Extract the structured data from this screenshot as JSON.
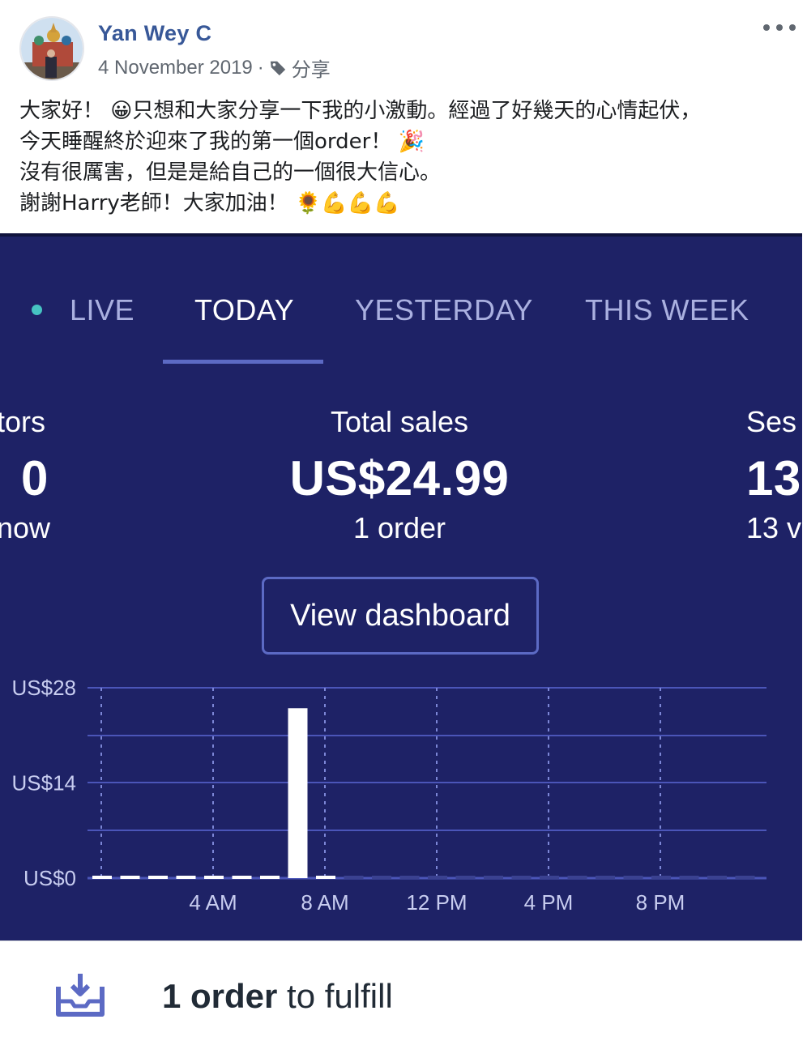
{
  "post": {
    "author": "Yan Wey C",
    "date": "4 November 2019",
    "separator": "·",
    "share_label": "分享",
    "lines": [
      "大家好！ 😀只想和大家分享一下我的小激動。經過了好幾天的心情起伏，",
      "今天睡醒終於迎來了我的第一個order！ 🎉",
      "沒有很厲害，但是是給自己的一個很大信心。",
      "謝謝Harry老師！大家加油！ 🌻💪💪💪"
    ]
  },
  "dashboard": {
    "tabs": [
      {
        "label": "LIVE",
        "active": false
      },
      {
        "label": "TODAY",
        "active": true
      },
      {
        "label": "YESTERDAY",
        "active": false
      },
      {
        "label": "THIS WEEK",
        "active": false
      }
    ],
    "metrics": {
      "visitors": {
        "label": "tors",
        "value": "0",
        "sub": "now"
      },
      "total_sales": {
        "label": "Total sales",
        "value": "US$24.99",
        "sub": "1 order"
      },
      "sessions": {
        "label": "Ses",
        "value": "13",
        "sub": "13 v"
      }
    },
    "view_dashboard_label": "View dashboard",
    "colors": {
      "background": "#1e2266",
      "accent": "#5c6ac4",
      "live_dot": "#46c3c2",
      "bar": "#ffffff"
    }
  },
  "chart_data": {
    "type": "bar",
    "y_ticks": [
      "US$28",
      "US$14",
      "US$0"
    ],
    "x_ticks": [
      "4 AM",
      "8 AM",
      "12 PM",
      "4 PM",
      "8 PM"
    ],
    "ylim": [
      0,
      28
    ],
    "categories": [
      "0",
      "1",
      "2",
      "3",
      "4",
      "5",
      "6",
      "7",
      "8",
      "9",
      "10",
      "11",
      "12",
      "13",
      "14",
      "15",
      "16",
      "17",
      "18",
      "19",
      "20",
      "21",
      "22",
      "23"
    ],
    "values": [
      0,
      0,
      0,
      0,
      0,
      0,
      0,
      24.99,
      0,
      0,
      0,
      0,
      0,
      0,
      0,
      0,
      0,
      0,
      0,
      0,
      0,
      0,
      0,
      0
    ],
    "current_hour": 8,
    "grid": true
  },
  "footer": {
    "count_text": "1 order",
    "rest_text": " to fulfill",
    "icon": "inbox-download-icon"
  }
}
